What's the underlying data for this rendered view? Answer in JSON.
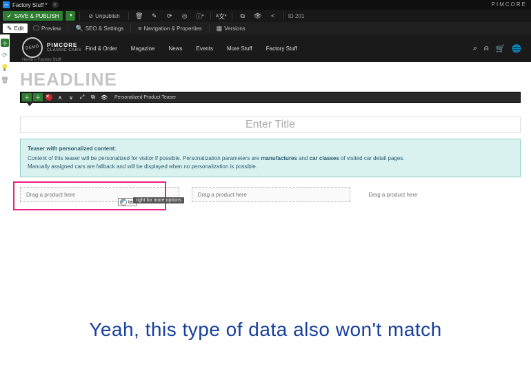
{
  "titlebar": {
    "tab_title": "Factory Stuff *",
    "brand": "PIMCORE"
  },
  "actionbar": {
    "save_publish": "SAVE & PUBLISH",
    "unpublish": "Unpublish",
    "id_label": "ID 201"
  },
  "toolbar2": {
    "edit": "Edit",
    "preview": "Preview",
    "seo": "SEO & Settings",
    "nav": "Navigation & Properties",
    "versions": "Versions"
  },
  "site": {
    "logo_line1": "PIMCORE",
    "logo_line2": "CLASSIC CARS",
    "logo_badge": "DEMO",
    "breadcrumb": "Home » Factory Stuff",
    "nav": {
      "find": "Find & Order",
      "magazine": "Magazine",
      "news": "News",
      "events": "Events",
      "more": "More Stuff",
      "factory": "Factory Stuff"
    }
  },
  "page": {
    "headline_placeholder": "HEADLINE",
    "block_toolbar_label": "Personalized Product Teaser",
    "title_placeholder": "Enter Title",
    "info": {
      "title": "Teaser with personalized content:",
      "l1a": "Content of this teaser will be personalized for visitor if possible. Personalization parameters are ",
      "b1": "manufactures",
      "l1b": " and ",
      "b2": "car classes",
      "l1c": " of visited car detail pages.",
      "l2": "Manually assigned cars are fallback and will be displayed when no personalization is possible."
    },
    "dropzone_text": "Drag a product here",
    "tooltip": "right for more options",
    "cursor_tag": "tax"
  },
  "caption": "Yeah, this type of data also won't match"
}
